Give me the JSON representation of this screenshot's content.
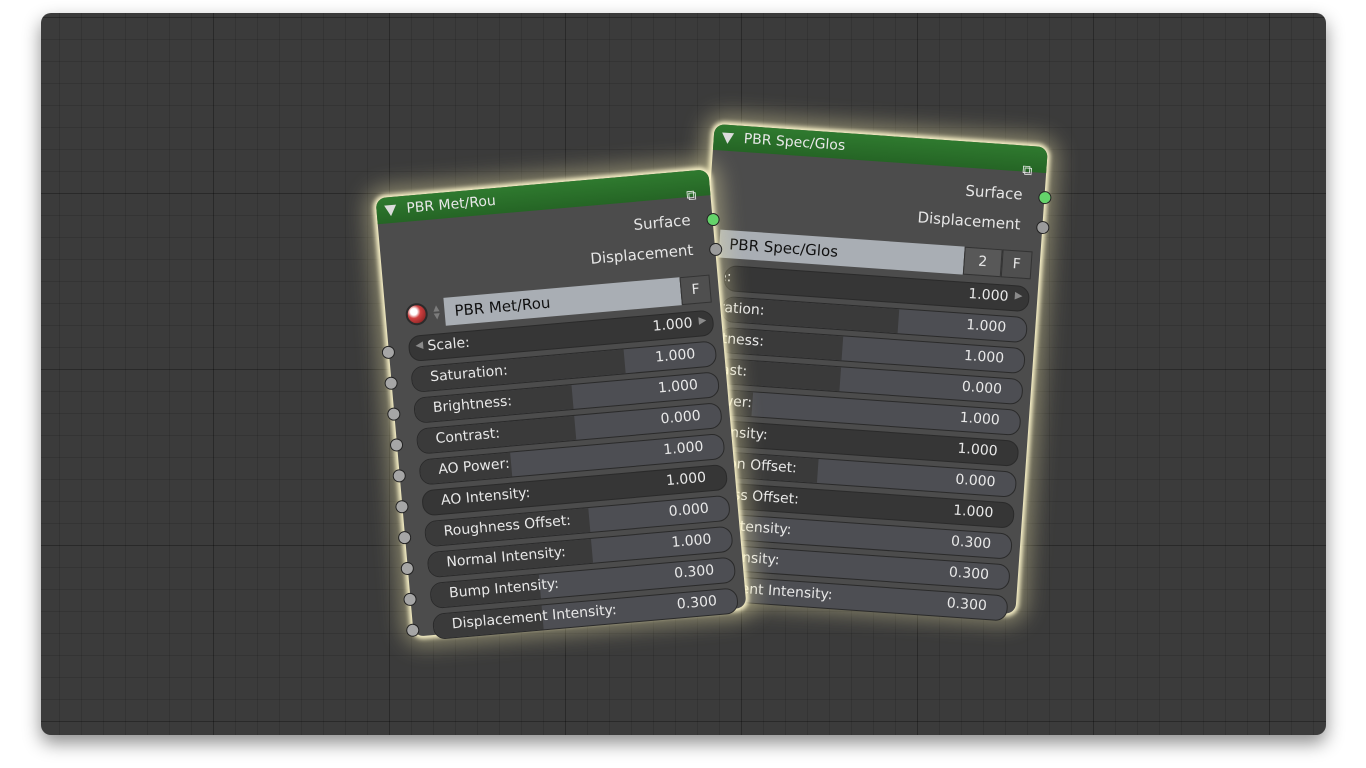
{
  "nodes": [
    {
      "title": "PBR Met/Rou",
      "outputs": [
        "Surface",
        "Displacement"
      ],
      "material_name": "PBR Met/Rou",
      "fake_user": "F",
      "fields": [
        {
          "label": "Scale:",
          "value": "1.000"
        },
        {
          "label": "Saturation:",
          "value": "1.000"
        },
        {
          "label": "Brightness:",
          "value": "1.000"
        },
        {
          "label": "Contrast:",
          "value": "0.000"
        },
        {
          "label": "AO Power:",
          "value": "1.000"
        },
        {
          "label": "AO Intensity:",
          "value": "1.000"
        },
        {
          "label": "Roughness Offset:",
          "value": "0.000"
        },
        {
          "label": "Normal Intensity:",
          "value": "1.000"
        },
        {
          "label": "Bump Intensity:",
          "value": "0.300"
        },
        {
          "label": "Displacement Intensity:",
          "value": "0.300"
        }
      ]
    },
    {
      "title": "PBR Spec/Glos",
      "outputs": [
        "Surface",
        "Displacement"
      ],
      "material_name": "PBR Spec/Glos",
      "users": "2",
      "fake_user": "F",
      "fields": [
        {
          "label": "Scale:",
          "value": "1.000"
        },
        {
          "label": "Saturation:",
          "value": "1.000"
        },
        {
          "label": "Brightness:",
          "value": "1.000"
        },
        {
          "label": "Contrast:",
          "value": "0.000"
        },
        {
          "label": "AO Power:",
          "value": "1.000"
        },
        {
          "label": "AO Intensity:",
          "value": "1.000"
        },
        {
          "label": "Reflection Offset:",
          "value": "0.000"
        },
        {
          "label": "Glossiness Offset:",
          "value": "1.000"
        },
        {
          "label": "Normal Intensity:",
          "value": "0.300"
        },
        {
          "label": "Bump Intensity:",
          "value": "0.300"
        },
        {
          "label": "Displacement Intensity:",
          "value": "0.300"
        }
      ]
    }
  ]
}
